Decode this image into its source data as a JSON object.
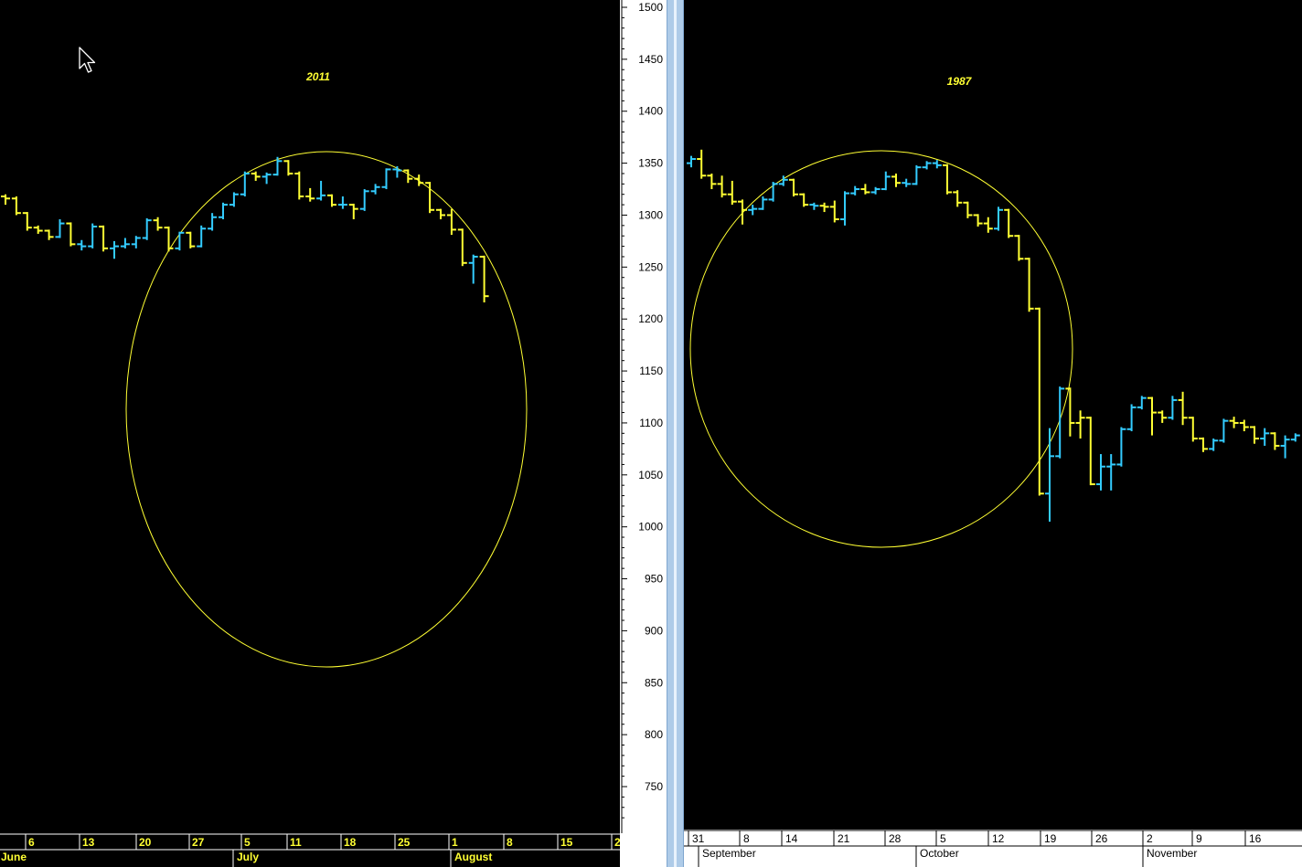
{
  "colors": {
    "up": "#33ccff",
    "down": "#ffff33",
    "ellipse": "#ffff33",
    "background": "#000000",
    "axis_panel": "#ffffff"
  },
  "chart_data": [
    {
      "type": "ohlc-bar",
      "title": "2011",
      "ylim": [
        700,
        1500
      ],
      "x_day_labels": [
        "6",
        "13",
        "20",
        "27",
        "5",
        "11",
        "18",
        "25",
        "1",
        "8",
        "15",
        "2"
      ],
      "x_month_labels": [
        "June",
        "July",
        "August"
      ],
      "bars": [
        {
          "open": 1318,
          "high": 1320,
          "low": 1310,
          "close": 1316,
          "dir": "down"
        },
        {
          "open": 1316,
          "high": 1318,
          "low": 1300,
          "close": 1302,
          "dir": "down"
        },
        {
          "open": 1302,
          "high": 1303,
          "low": 1285,
          "close": 1288,
          "dir": "down"
        },
        {
          "open": 1288,
          "high": 1290,
          "low": 1282,
          "close": 1285,
          "dir": "down"
        },
        {
          "open": 1285,
          "high": 1286,
          "low": 1276,
          "close": 1279,
          "dir": "down"
        },
        {
          "open": 1279,
          "high": 1296,
          "low": 1278,
          "close": 1292,
          "dir": "up"
        },
        {
          "open": 1292,
          "high": 1293,
          "low": 1270,
          "close": 1272,
          "dir": "down"
        },
        {
          "open": 1272,
          "high": 1276,
          "low": 1266,
          "close": 1270,
          "dir": "up"
        },
        {
          "open": 1270,
          "high": 1292,
          "low": 1268,
          "close": 1289,
          "dir": "up"
        },
        {
          "open": 1289,
          "high": 1290,
          "low": 1265,
          "close": 1268,
          "dir": "down"
        },
        {
          "open": 1268,
          "high": 1275,
          "low": 1258,
          "close": 1270,
          "dir": "up"
        },
        {
          "open": 1270,
          "high": 1278,
          "low": 1268,
          "close": 1272,
          "dir": "up"
        },
        {
          "open": 1272,
          "high": 1280,
          "low": 1268,
          "close": 1278,
          "dir": "up"
        },
        {
          "open": 1278,
          "high": 1297,
          "low": 1276,
          "close": 1295,
          "dir": "up"
        },
        {
          "open": 1295,
          "high": 1298,
          "low": 1285,
          "close": 1288,
          "dir": "down"
        },
        {
          "open": 1288,
          "high": 1289,
          "low": 1265,
          "close": 1268,
          "dir": "down"
        },
        {
          "open": 1268,
          "high": 1284,
          "low": 1266,
          "close": 1283,
          "dir": "up"
        },
        {
          "open": 1283,
          "high": 1284,
          "low": 1268,
          "close": 1270,
          "dir": "down"
        },
        {
          "open": 1270,
          "high": 1290,
          "low": 1269,
          "close": 1287,
          "dir": "up"
        },
        {
          "open": 1287,
          "high": 1302,
          "low": 1285,
          "close": 1298,
          "dir": "up"
        },
        {
          "open": 1298,
          "high": 1312,
          "low": 1296,
          "close": 1310,
          "dir": "up"
        },
        {
          "open": 1310,
          "high": 1322,
          "low": 1308,
          "close": 1320,
          "dir": "up"
        },
        {
          "open": 1320,
          "high": 1342,
          "low": 1318,
          "close": 1340,
          "dir": "up"
        },
        {
          "open": 1340,
          "high": 1342,
          "low": 1333,
          "close": 1337,
          "dir": "down"
        },
        {
          "open": 1337,
          "high": 1341,
          "low": 1330,
          "close": 1339,
          "dir": "up"
        },
        {
          "open": 1339,
          "high": 1356,
          "low": 1338,
          "close": 1352,
          "dir": "up"
        },
        {
          "open": 1352,
          "high": 1353,
          "low": 1338,
          "close": 1340,
          "dir": "down"
        },
        {
          "open": 1340,
          "high": 1342,
          "low": 1315,
          "close": 1318,
          "dir": "down"
        },
        {
          "open": 1318,
          "high": 1326,
          "low": 1313,
          "close": 1316,
          "dir": "down"
        },
        {
          "open": 1316,
          "high": 1333,
          "low": 1314,
          "close": 1319,
          "dir": "up"
        },
        {
          "open": 1319,
          "high": 1320,
          "low": 1308,
          "close": 1310,
          "dir": "down"
        },
        {
          "open": 1310,
          "high": 1318,
          "low": 1306,
          "close": 1310,
          "dir": "up"
        },
        {
          "open": 1310,
          "high": 1311,
          "low": 1296,
          "close": 1306,
          "dir": "down"
        },
        {
          "open": 1306,
          "high": 1325,
          "low": 1304,
          "close": 1323,
          "dir": "up"
        },
        {
          "open": 1323,
          "high": 1330,
          "low": 1320,
          "close": 1327,
          "dir": "up"
        },
        {
          "open": 1327,
          "high": 1345,
          "low": 1325,
          "close": 1344,
          "dir": "up"
        },
        {
          "open": 1344,
          "high": 1347,
          "low": 1336,
          "close": 1343,
          "dir": "up"
        },
        {
          "open": 1343,
          "high": 1344,
          "low": 1331,
          "close": 1335,
          "dir": "down"
        },
        {
          "open": 1335,
          "high": 1339,
          "low": 1328,
          "close": 1331,
          "dir": "down"
        },
        {
          "open": 1331,
          "high": 1332,
          "low": 1302,
          "close": 1305,
          "dir": "down"
        },
        {
          "open": 1305,
          "high": 1306,
          "low": 1296,
          "close": 1300,
          "dir": "down"
        },
        {
          "open": 1300,
          "high": 1306,
          "low": 1281,
          "close": 1286,
          "dir": "down"
        },
        {
          "open": 1286,
          "high": 1287,
          "low": 1251,
          "close": 1254,
          "dir": "down"
        },
        {
          "open": 1254,
          "high": 1262,
          "low": 1234,
          "close": 1260,
          "dir": "up"
        },
        {
          "open": 1260,
          "high": 1261,
          "low": 1216,
          "close": 1222,
          "dir": "down"
        }
      ]
    },
    {
      "type": "ohlc-bar",
      "title": "1987",
      "ylim": [
        700,
        1500
      ],
      "y_ticks": [
        1500,
        1450,
        1400,
        1350,
        1300,
        1250,
        1200,
        1150,
        1100,
        1050,
        1000,
        950,
        900,
        850,
        800,
        750
      ],
      "x_day_labels": [
        "31",
        "8",
        "14",
        "21",
        "28",
        "5",
        "12",
        "19",
        "26",
        "2",
        "9",
        "16"
      ],
      "x_month_labels": [
        "September",
        "October",
        "November"
      ],
      "bars": [
        {
          "open": 1350,
          "high": 1357,
          "low": 1346,
          "close": 1354,
          "dir": "up"
        },
        {
          "open": 1354,
          "high": 1363,
          "low": 1335,
          "close": 1338,
          "dir": "down"
        },
        {
          "open": 1338,
          "high": 1340,
          "low": 1325,
          "close": 1330,
          "dir": "down"
        },
        {
          "open": 1330,
          "high": 1338,
          "low": 1317,
          "close": 1320,
          "dir": "down"
        },
        {
          "open": 1320,
          "high": 1333,
          "low": 1310,
          "close": 1313,
          "dir": "down"
        },
        {
          "open": 1313,
          "high": 1315,
          "low": 1291,
          "close": 1305,
          "dir": "down"
        },
        {
          "open": 1305,
          "high": 1310,
          "low": 1300,
          "close": 1306,
          "dir": "up"
        },
        {
          "open": 1306,
          "high": 1318,
          "low": 1305,
          "close": 1315,
          "dir": "up"
        },
        {
          "open": 1315,
          "high": 1332,
          "low": 1313,
          "close": 1330,
          "dir": "up"
        },
        {
          "open": 1330,
          "high": 1338,
          "low": 1328,
          "close": 1334,
          "dir": "up"
        },
        {
          "open": 1334,
          "high": 1335,
          "low": 1318,
          "close": 1320,
          "dir": "down"
        },
        {
          "open": 1320,
          "high": 1321,
          "low": 1308,
          "close": 1310,
          "dir": "down"
        },
        {
          "open": 1310,
          "high": 1312,
          "low": 1305,
          "close": 1309,
          "dir": "up"
        },
        {
          "open": 1309,
          "high": 1312,
          "low": 1303,
          "close": 1308,
          "dir": "down"
        },
        {
          "open": 1308,
          "high": 1314,
          "low": 1293,
          "close": 1296,
          "dir": "down"
        },
        {
          "open": 1296,
          "high": 1323,
          "low": 1290,
          "close": 1321,
          "dir": "up"
        },
        {
          "open": 1321,
          "high": 1328,
          "low": 1319,
          "close": 1325,
          "dir": "up"
        },
        {
          "open": 1325,
          "high": 1330,
          "low": 1320,
          "close": 1322,
          "dir": "down"
        },
        {
          "open": 1322,
          "high": 1327,
          "low": 1320,
          "close": 1325,
          "dir": "up"
        },
        {
          "open": 1325,
          "high": 1342,
          "low": 1324,
          "close": 1337,
          "dir": "up"
        },
        {
          "open": 1337,
          "high": 1340,
          "low": 1327,
          "close": 1331,
          "dir": "down"
        },
        {
          "open": 1331,
          "high": 1335,
          "low": 1327,
          "close": 1330,
          "dir": "up"
        },
        {
          "open": 1330,
          "high": 1348,
          "low": 1329,
          "close": 1346,
          "dir": "up"
        },
        {
          "open": 1346,
          "high": 1352,
          "low": 1344,
          "close": 1350,
          "dir": "up"
        },
        {
          "open": 1350,
          "high": 1353,
          "low": 1345,
          "close": 1348,
          "dir": "up"
        },
        {
          "open": 1348,
          "high": 1349,
          "low": 1320,
          "close": 1322,
          "dir": "down"
        },
        {
          "open": 1322,
          "high": 1324,
          "low": 1308,
          "close": 1312,
          "dir": "down"
        },
        {
          "open": 1312,
          "high": 1313,
          "low": 1297,
          "close": 1300,
          "dir": "down"
        },
        {
          "open": 1300,
          "high": 1301,
          "low": 1289,
          "close": 1292,
          "dir": "down"
        },
        {
          "open": 1292,
          "high": 1298,
          "low": 1283,
          "close": 1287,
          "dir": "down"
        },
        {
          "open": 1287,
          "high": 1308,
          "low": 1285,
          "close": 1305,
          "dir": "up"
        },
        {
          "open": 1305,
          "high": 1306,
          "low": 1278,
          "close": 1280,
          "dir": "down"
        },
        {
          "open": 1280,
          "high": 1281,
          "low": 1256,
          "close": 1258,
          "dir": "down"
        },
        {
          "open": 1258,
          "high": 1259,
          "low": 1207,
          "close": 1210,
          "dir": "down"
        },
        {
          "open": 1210,
          "high": 1211,
          "low": 1030,
          "close": 1032,
          "dir": "down"
        },
        {
          "open": 1032,
          "high": 1095,
          "low": 1005,
          "close": 1068,
          "dir": "up"
        },
        {
          "open": 1068,
          "high": 1135,
          "low": 1066,
          "close": 1133,
          "dir": "up"
        },
        {
          "open": 1133,
          "high": 1134,
          "low": 1087,
          "close": 1100,
          "dir": "down"
        },
        {
          "open": 1100,
          "high": 1112,
          "low": 1085,
          "close": 1105,
          "dir": "down"
        },
        {
          "open": 1105,
          "high": 1106,
          "low": 1040,
          "close": 1041,
          "dir": "down"
        },
        {
          "open": 1041,
          "high": 1070,
          "low": 1035,
          "close": 1058,
          "dir": "up"
        },
        {
          "open": 1058,
          "high": 1070,
          "low": 1035,
          "close": 1060,
          "dir": "up"
        },
        {
          "open": 1060,
          "high": 1096,
          "low": 1058,
          "close": 1094,
          "dir": "up"
        },
        {
          "open": 1094,
          "high": 1118,
          "low": 1092,
          "close": 1115,
          "dir": "up"
        },
        {
          "open": 1115,
          "high": 1126,
          "low": 1113,
          "close": 1124,
          "dir": "up"
        },
        {
          "open": 1124,
          "high": 1125,
          "low": 1088,
          "close": 1110,
          "dir": "down"
        },
        {
          "open": 1110,
          "high": 1112,
          "low": 1100,
          "close": 1105,
          "dir": "down"
        },
        {
          "open": 1105,
          "high": 1126,
          "low": 1103,
          "close": 1122,
          "dir": "up"
        },
        {
          "open": 1122,
          "high": 1130,
          "low": 1098,
          "close": 1105,
          "dir": "down"
        },
        {
          "open": 1105,
          "high": 1106,
          "low": 1082,
          "close": 1085,
          "dir": "down"
        },
        {
          "open": 1085,
          "high": 1086,
          "low": 1072,
          "close": 1075,
          "dir": "down"
        },
        {
          "open": 1075,
          "high": 1085,
          "low": 1073,
          "close": 1083,
          "dir": "up"
        },
        {
          "open": 1083,
          "high": 1104,
          "low": 1081,
          "close": 1102,
          "dir": "up"
        },
        {
          "open": 1102,
          "high": 1106,
          "low": 1095,
          "close": 1100,
          "dir": "down"
        },
        {
          "open": 1100,
          "high": 1103,
          "low": 1092,
          "close": 1096,
          "dir": "down"
        },
        {
          "open": 1096,
          "high": 1097,
          "low": 1080,
          "close": 1085,
          "dir": "down"
        },
        {
          "open": 1085,
          "high": 1095,
          "low": 1078,
          "close": 1090,
          "dir": "up"
        },
        {
          "open": 1090,
          "high": 1091,
          "low": 1074,
          "close": 1078,
          "dir": "down"
        },
        {
          "open": 1078,
          "high": 1088,
          "low": 1066,
          "close": 1084,
          "dir": "up"
        },
        {
          "open": 1084,
          "high": 1090,
          "low": 1082,
          "close": 1088,
          "dir": "up"
        }
      ]
    }
  ]
}
